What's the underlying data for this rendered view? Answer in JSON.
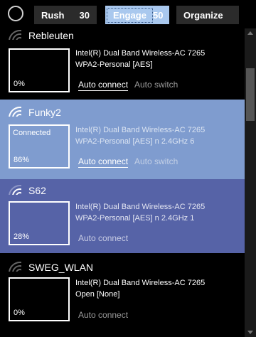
{
  "tabs": [
    {
      "label": "Rush",
      "count": "30"
    },
    {
      "label": "Engage",
      "count": "50"
    },
    {
      "label": "Organize",
      "count": ""
    }
  ],
  "networks": [
    {
      "ssid": "Rebleuten",
      "status": "",
      "percent": "0%",
      "adapter": "Intel(R) Dual Band Wireless-AC 7265",
      "security": "WPA2-Personal [AES]",
      "auto_connect": "Auto connect",
      "auto_switch": "Auto switch"
    },
    {
      "ssid": "Funky2",
      "status": "Connected",
      "percent": "86%",
      "adapter": "Intel(R) Dual Band Wireless-AC 7265",
      "security": "WPA2-Personal [AES] n 2.4GHz 6",
      "auto_connect": "Auto connect",
      "auto_switch": "Auto switch"
    },
    {
      "ssid": "S62",
      "status": "",
      "percent": "28%",
      "adapter": "Intel(R) Dual Band Wireless-AC 7265",
      "security": "WPA2-Personal [AES] n 2.4GHz 1",
      "auto_connect": "Auto connect"
    },
    {
      "ssid": "SWEG_WLAN",
      "status": "",
      "percent": "0%",
      "adapter": "Intel(R) Dual Band Wireless-AC 7265",
      "security": "Open [None]",
      "auto_connect": "Auto connect"
    }
  ],
  "colors": {
    "selected_tab": "#a9c8ee",
    "connected_row": "#7f9ccf",
    "hover_row": "#5663a7",
    "background": "#000000"
  }
}
